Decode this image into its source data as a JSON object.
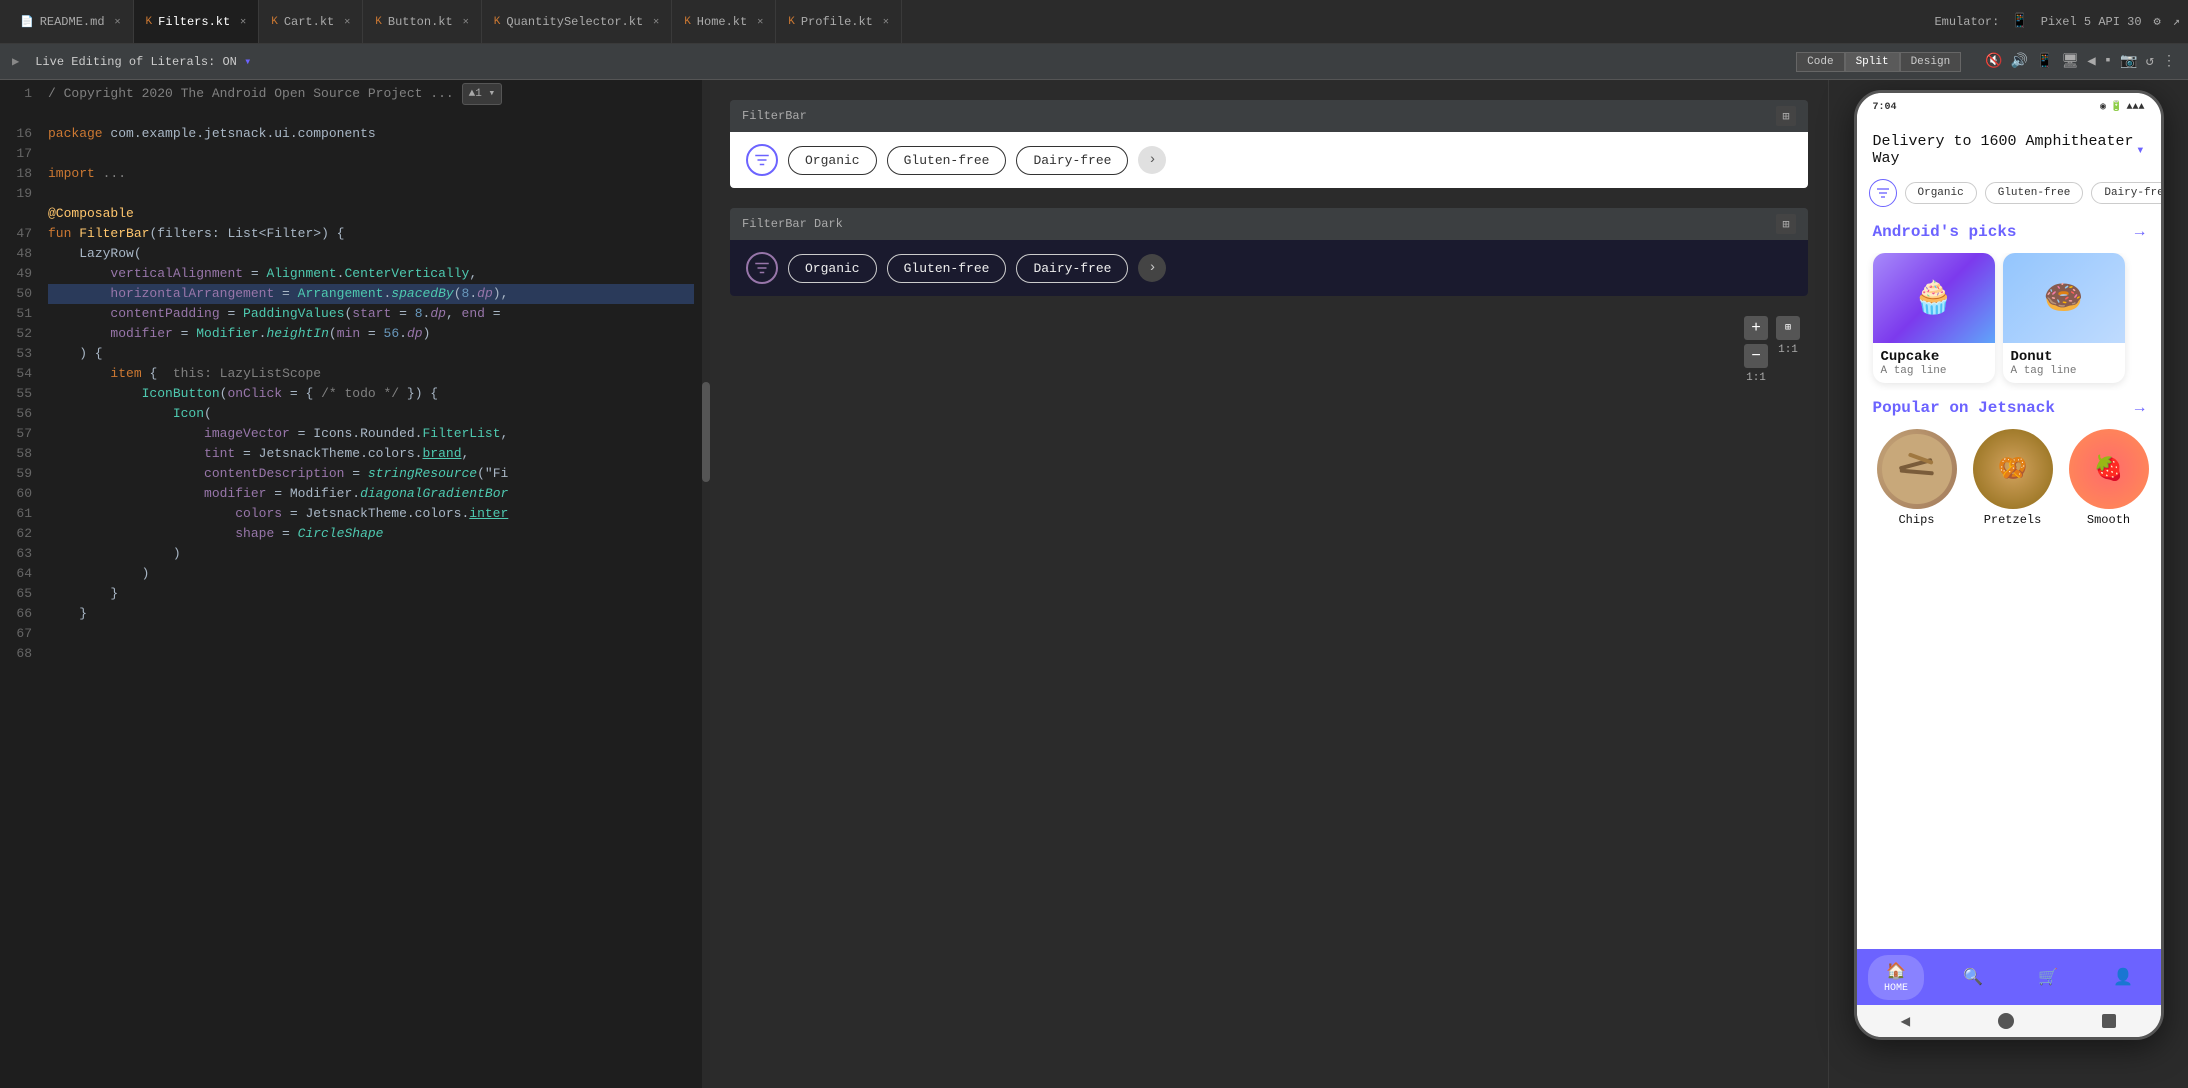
{
  "topbar": {
    "tabs": [
      {
        "id": "readme",
        "label": "README.md",
        "icon": "md",
        "active": false
      },
      {
        "id": "filters",
        "label": "Filters.kt",
        "icon": "kt",
        "active": true
      },
      {
        "id": "cart",
        "label": "Cart.kt",
        "icon": "kt",
        "active": false
      },
      {
        "id": "button",
        "label": "Button.kt",
        "icon": "kt",
        "active": false
      },
      {
        "id": "quantityselector",
        "label": "QuantitySelector.kt",
        "icon": "kt",
        "active": false
      },
      {
        "id": "home",
        "label": "Home.kt",
        "icon": "kt",
        "active": false
      },
      {
        "id": "profile",
        "label": "Profile.kt",
        "icon": "kt",
        "active": false
      }
    ],
    "right": {
      "emulator_label": "Emulator:",
      "device": "Pixel 5 API 30",
      "settings_icon": "⚙",
      "share_icon": "↗"
    }
  },
  "toolbar": {
    "live_editing": "Live Editing of Literals: ON",
    "code_btn": "Code",
    "split_btn": "Split",
    "design_btn": "Design",
    "icons": [
      "🔇",
      "🔔",
      "📱",
      "🖥",
      "◀",
      "▪",
      "📷",
      "↺",
      "⋮"
    ]
  },
  "code": {
    "lines": [
      {
        "num": 1,
        "content": "/ Copyright 2020 The Android Open Source Project ...",
        "highlight": false
      },
      {
        "num": 16,
        "content": "",
        "highlight": false
      },
      {
        "num": 17,
        "content": "package com.example.jetsnack.ui.components",
        "highlight": false
      },
      {
        "num": 18,
        "content": "",
        "highlight": false
      },
      {
        "num": 19,
        "content": "import ...",
        "highlight": false
      },
      {
        "num": 47,
        "content": "",
        "highlight": false
      },
      {
        "num": 48,
        "content": "@Composable",
        "highlight": false
      },
      {
        "num": 49,
        "content": "fun FilterBar(filters: List<Filter>) {",
        "highlight": false
      },
      {
        "num": 50,
        "content": "    LazyRow(",
        "highlight": false
      },
      {
        "num": 51,
        "content": "        verticalAlignment = Alignment.CenterVertically,",
        "highlight": false
      },
      {
        "num": 52,
        "content": "        horizontalArrangement = Arrangement.spacedBy(8.dp),",
        "highlight": true
      },
      {
        "num": 53,
        "content": "        contentPadding = PaddingValues(start = 8.dp, end =",
        "highlight": false
      },
      {
        "num": 54,
        "content": "        modifier = Modifier.heightIn(min = 56.dp)",
        "highlight": false
      },
      {
        "num": 55,
        "content": "    ) {",
        "highlight": false
      },
      {
        "num": 56,
        "content": "        item {  this: LazyListScope",
        "highlight": false
      },
      {
        "num": 57,
        "content": "            IconButton(onClick = { /* todo */ }) {",
        "highlight": false
      },
      {
        "num": 58,
        "content": "                Icon(",
        "highlight": false
      },
      {
        "num": 59,
        "content": "                    imageVector = Icons.Rounded.FilterList,",
        "highlight": false
      },
      {
        "num": 60,
        "content": "                    tint = JetsnackTheme.colors.brand,",
        "highlight": false
      },
      {
        "num": 61,
        "content": "                    contentDescription = stringResource(\"Fi",
        "highlight": false
      },
      {
        "num": 62,
        "content": "                    modifier = Modifier.diagonalGradientBor",
        "highlight": false
      },
      {
        "num": 63,
        "content": "                        colors = JetsnackTheme.colors.inter",
        "highlight": false
      },
      {
        "num": 64,
        "content": "                        shape = CircleShape",
        "highlight": false
      },
      {
        "num": 65,
        "content": "                )",
        "highlight": false
      },
      {
        "num": 66,
        "content": "            )",
        "highlight": false
      },
      {
        "num": 67,
        "content": "        }",
        "highlight": false
      },
      {
        "num": 68,
        "content": "    }",
        "highlight": false
      }
    ]
  },
  "preview": {
    "filterbar_light": {
      "title": "FilterBar",
      "chips": [
        "Organic",
        "Gluten-free",
        "Dairy-free"
      ]
    },
    "filterbar_dark": {
      "title": "FilterBar Dark",
      "chips": [
        "Organic",
        "Gluten-free",
        "Dairy-free"
      ]
    }
  },
  "phone": {
    "status_time": "7:04",
    "delivery_text": "Delivery to 1600 Amphitheater Way",
    "filters": [
      "Organic",
      "Gluten-free",
      "Dairy-free"
    ],
    "androids_picks_title": "Android's picks",
    "products": [
      {
        "name": "Cupcake",
        "tag": "A tag line",
        "emoji": "🧁"
      },
      {
        "name": "Donut",
        "tag": "A tag line",
        "emoji": "🍩"
      }
    ],
    "popular_title": "Popular on Jetsnack",
    "popular_items": [
      {
        "name": "Chips",
        "emoji": "🥔"
      },
      {
        "name": "Pretzels",
        "emoji": "🥨"
      },
      {
        "name": "Smooth",
        "emoji": "🍓"
      }
    ],
    "nav_items": [
      {
        "label": "HOME",
        "icon": "🏠",
        "active": true
      },
      {
        "label": "",
        "icon": "🔍",
        "active": false
      },
      {
        "label": "",
        "icon": "🛒",
        "active": false
      },
      {
        "label": "",
        "icon": "👤",
        "active": false
      }
    ]
  },
  "colors": {
    "accent": "#6c63ff",
    "brand": "#6c63ff",
    "code_highlight": "#2a3a5a",
    "editor_bg": "#1e1e1e",
    "sidebar_bg": "#2b2b2b"
  }
}
